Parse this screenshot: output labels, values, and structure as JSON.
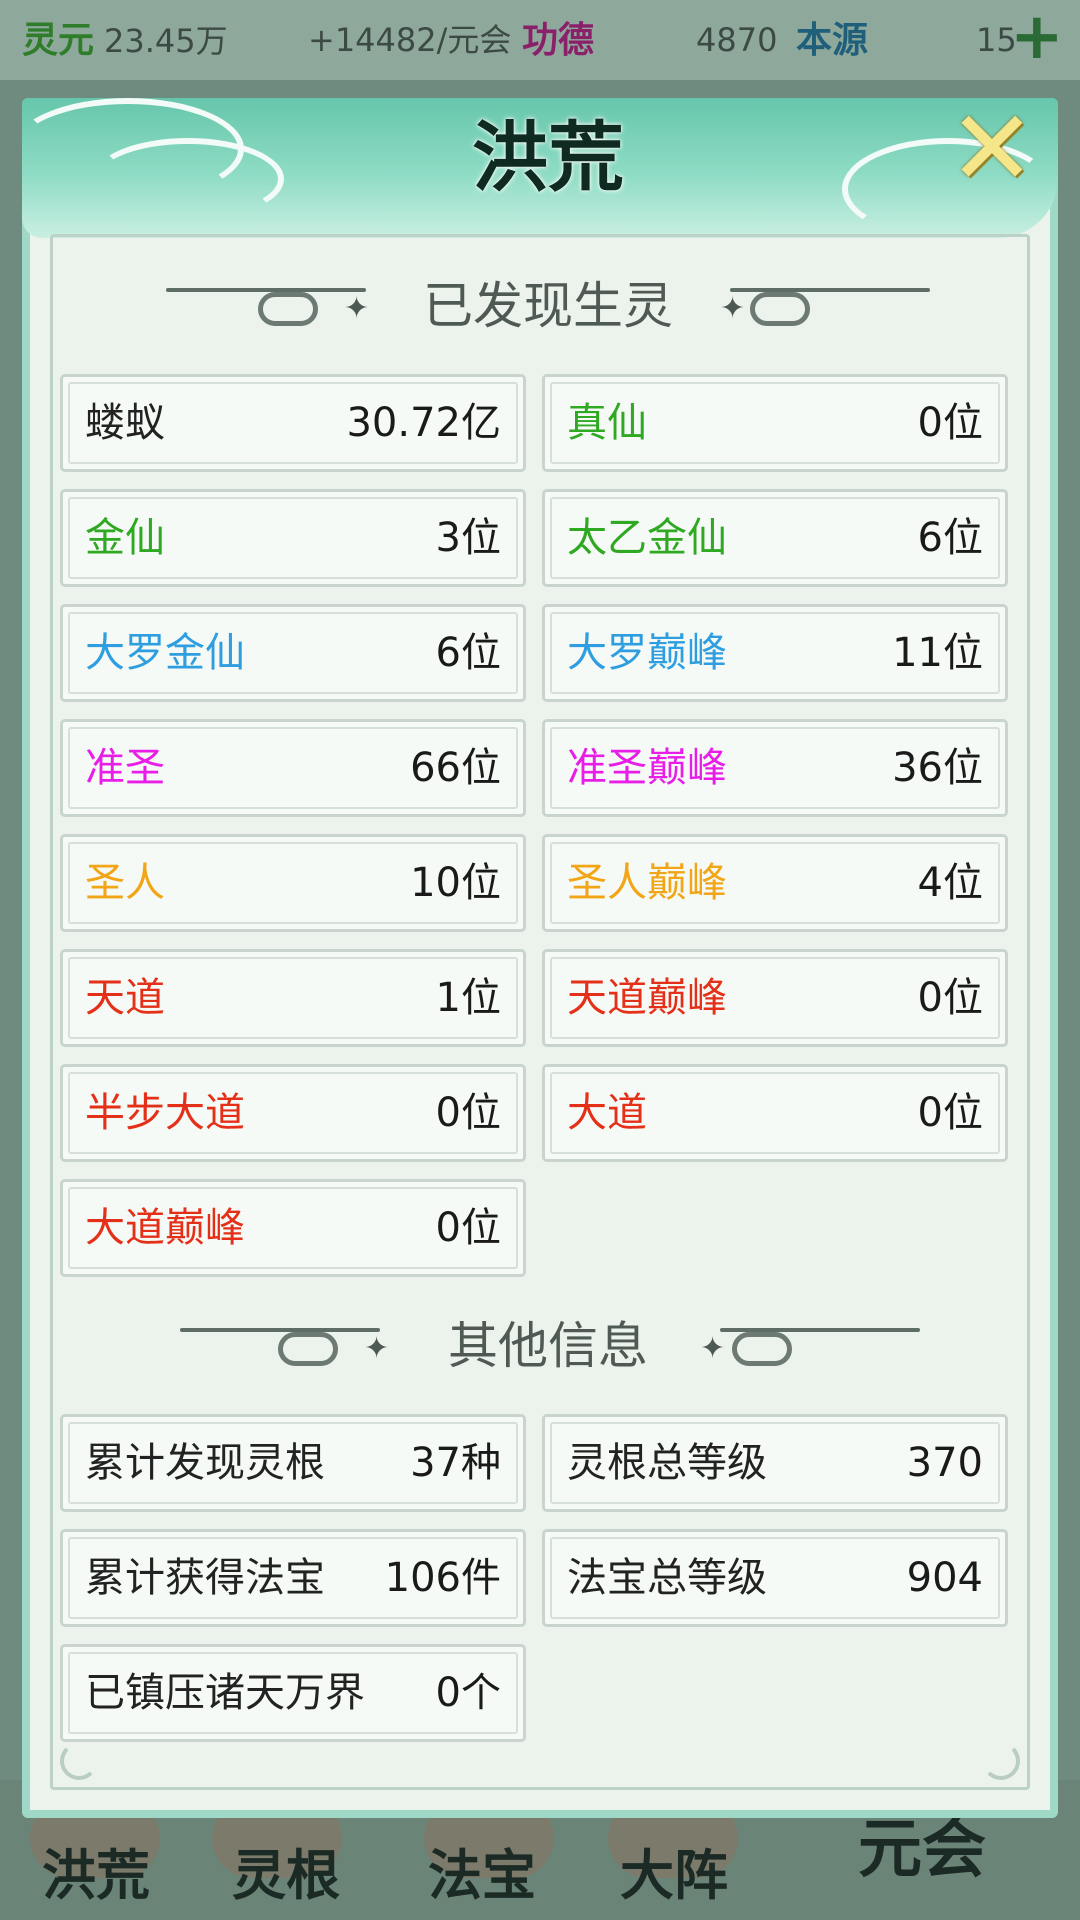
{
  "topbar": {
    "lingyuan_label": "灵元",
    "lingyuan_value": "23.45万",
    "rate": "+14482/元会",
    "gongde_label": "功德",
    "gongde_value": "4870",
    "benyuan_label": "本源",
    "benyuan_value": "15"
  },
  "modal": {
    "title": "洪荒",
    "section1_title": "已发现生灵",
    "section2_title": "其他信息",
    "beings": [
      {
        "name": "蝼蚁",
        "value": "30.72亿",
        "color": "#222222"
      },
      {
        "name": "真仙",
        "value": "0位",
        "color": "#2fa822"
      },
      {
        "name": "金仙",
        "value": "3位",
        "color": "#2fa822"
      },
      {
        "name": "太乙金仙",
        "value": "6位",
        "color": "#2fa822"
      },
      {
        "name": "大罗金仙",
        "value": "6位",
        "color": "#2e9ee0"
      },
      {
        "name": "大罗巅峰",
        "value": "11位",
        "color": "#2e9ee0"
      },
      {
        "name": "准圣",
        "value": "66位",
        "color": "#e81ee8"
      },
      {
        "name": "准圣巅峰",
        "value": "36位",
        "color": "#e81ee8"
      },
      {
        "name": "圣人",
        "value": "10位",
        "color": "#f2a516"
      },
      {
        "name": "圣人巅峰",
        "value": "4位",
        "color": "#f2a516"
      },
      {
        "name": "天道",
        "value": "1位",
        "color": "#e43018"
      },
      {
        "name": "天道巅峰",
        "value": "0位",
        "color": "#e43018"
      },
      {
        "name": "半步大道",
        "value": "0位",
        "color": "#e43018"
      },
      {
        "name": "大道",
        "value": "0位",
        "color": "#e43018"
      },
      {
        "name": "大道巅峰",
        "value": "0位",
        "color": "#e43018"
      }
    ],
    "other_info": [
      {
        "name": "累计发现灵根",
        "value": "37种"
      },
      {
        "name": "灵根总等级",
        "value": "370"
      },
      {
        "name": "累计获得法宝",
        "value": "106件"
      },
      {
        "name": "法宝总等级",
        "value": "904"
      },
      {
        "name": "已镇压诸天万界",
        "value": "0个"
      }
    ]
  },
  "bottom_nav": {
    "items": [
      "洪荒",
      "灵根",
      "法宝",
      "大阵",
      "元会"
    ]
  }
}
